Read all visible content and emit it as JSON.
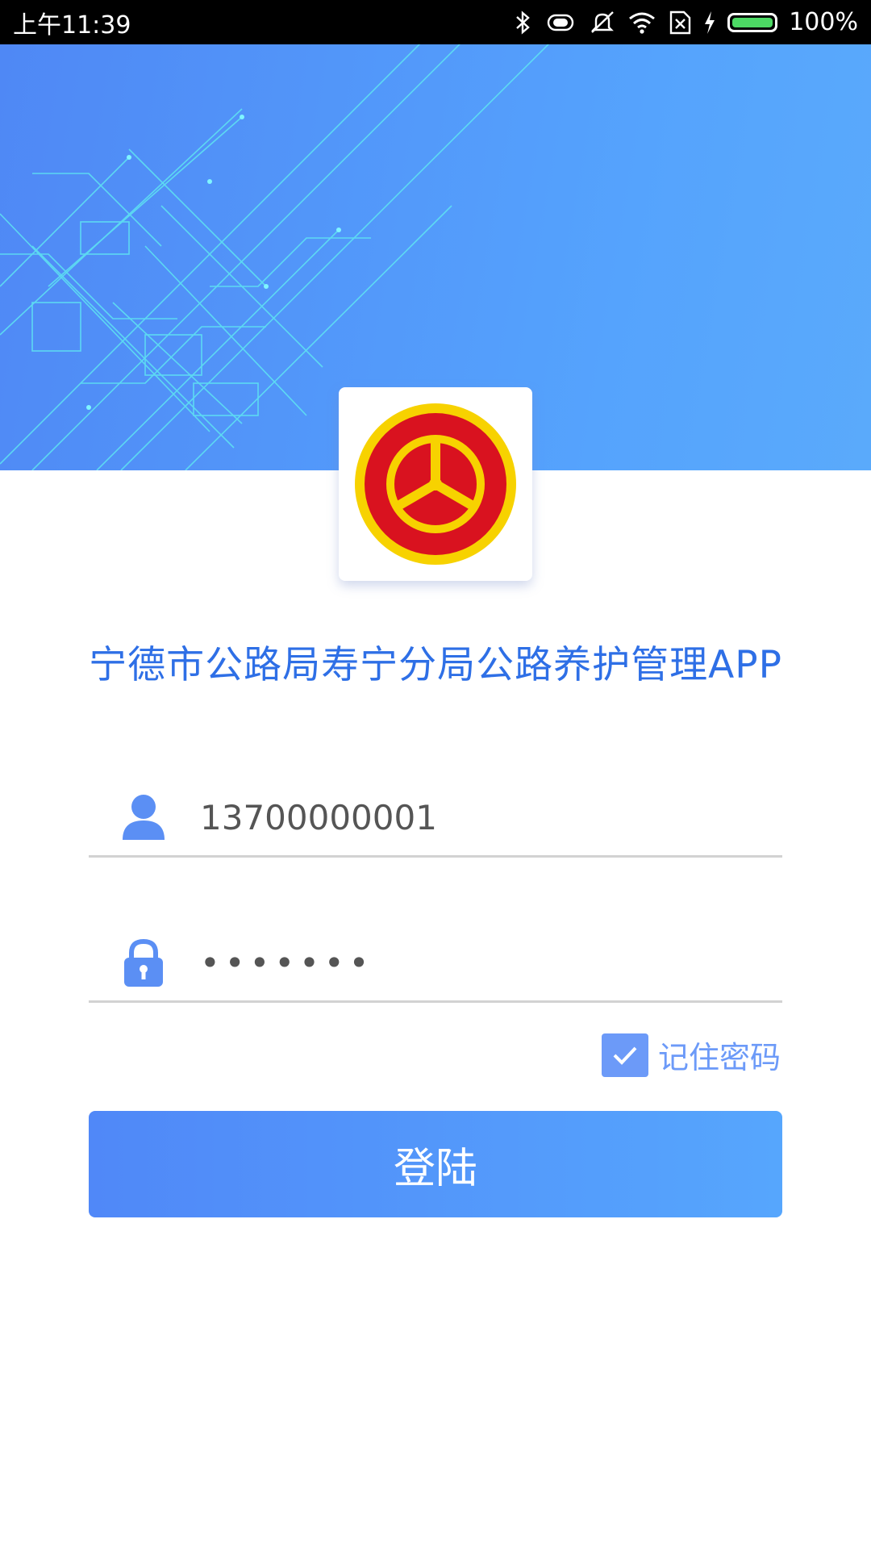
{
  "status_bar": {
    "time": "上午11:39",
    "battery": "100%",
    "icons": [
      "bluetooth-icon",
      "vibrate-icon",
      "mute-icon",
      "wifi-icon",
      "sim-x-icon",
      "charging-icon",
      "battery-icon"
    ]
  },
  "app": {
    "title": "宁德市公路局寿宁分局公路养护管理APP",
    "logo": "wheel-emblem-logo"
  },
  "form": {
    "username": {
      "value": "13700000001",
      "icon": "user-icon"
    },
    "password": {
      "value": "•••••••",
      "icon": "lock-icon"
    },
    "remember": {
      "label": "记住密码",
      "checked": true
    },
    "login_button": "登陆"
  },
  "colors": {
    "accent": "#2e6fe6",
    "header_start": "#4f88f5",
    "header_end": "#5aaafb",
    "checkbox": "#6c9af8",
    "emblem_red": "#d9121f",
    "emblem_yellow": "#f7d200"
  }
}
